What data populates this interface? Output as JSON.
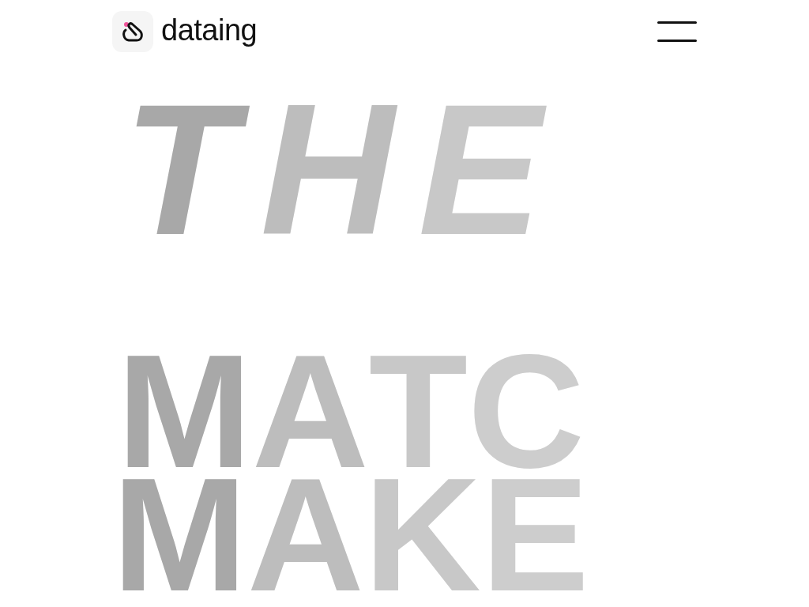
{
  "header": {
    "logo_text": "dataing"
  },
  "headline": [
    {
      "letters": [
        {
          "char": "T",
          "color": "#a8a8a8"
        },
        {
          "char": "H",
          "color": "#bdbdbd"
        },
        {
          "char": "E",
          "color": "#c8c8c8"
        }
      ]
    },
    {
      "letters": [
        {
          "char": "M",
          "color": "#a8a8a8"
        },
        {
          "char": "A",
          "color": "#bdbdbd"
        },
        {
          "char": "T",
          "color": "#c8c8c8"
        },
        {
          "char": "C",
          "color": "#cdcdcd"
        }
      ]
    },
    {
      "letters": [
        {
          "char": "M",
          "color": "#a8a8a8"
        },
        {
          "char": "A",
          "color": "#bdbdbd"
        },
        {
          "char": "K",
          "color": "#c8c8c8"
        },
        {
          "char": "E",
          "color": "#cdcdcd"
        }
      ]
    }
  ]
}
